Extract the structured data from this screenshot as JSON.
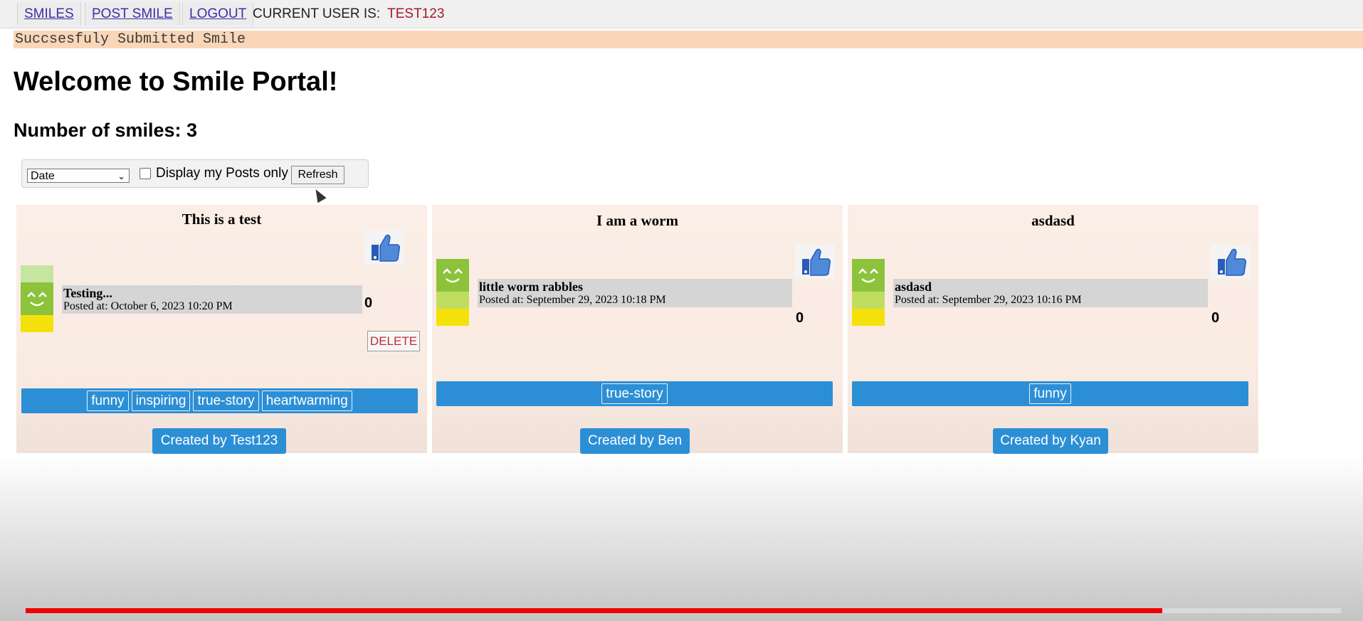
{
  "nav": {
    "links": [
      "SMILES",
      "POST SMILE",
      "LOGOUT"
    ],
    "current_user_label": "CURRENT USER IS:",
    "current_user": "TEST123"
  },
  "flash_message": "Succsesfuly Submitted Smile",
  "title": "Welcome to Smile Portal!",
  "smile_count_text": "Number of smiles: 3",
  "filter": {
    "sort_value": "Date",
    "my_posts_label": "Display my Posts only",
    "my_posts_checked": false,
    "refresh_label": "Refresh"
  },
  "cards": [
    {
      "title": "This is a test",
      "post_title": "Testing...",
      "posted_at": "Posted at: October 6, 2023 10:20 PM",
      "likes": "0",
      "delete_label": "DELETE",
      "tags": [
        "funny",
        "inspiring",
        "true-story",
        "heartwarming"
      ],
      "creator": "Created by Test123"
    },
    {
      "title": "I am a worm",
      "post_title": "little worm rabbles",
      "posted_at": "Posted at: September 29, 2023 10:18 PM",
      "likes": "0",
      "tags": [
        "true-story"
      ],
      "creator": "Created by Ben"
    },
    {
      "title": "asdasd",
      "post_title": "asdasd",
      "posted_at": "Posted at: September 29, 2023 10:16 PM",
      "likes": "0",
      "tags": [
        "funny"
      ],
      "creator": "Created by Kyan"
    }
  ],
  "video_progress": 0.864,
  "colors": {
    "accent": "#2c8fd6",
    "flash_bg": "#fad6b8",
    "user_name": "#a4192b",
    "card_bg": "#fbeee6",
    "progress": "#ee0000"
  }
}
